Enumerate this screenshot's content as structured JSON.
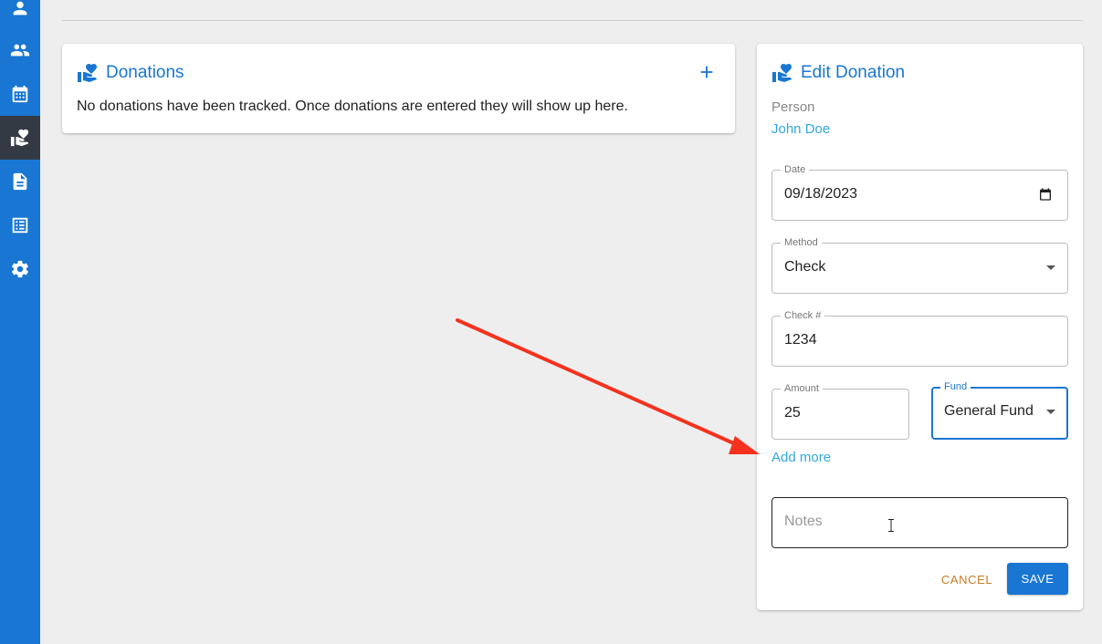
{
  "sidebar": {
    "items": [
      {
        "icon": "person-icon",
        "active": false
      },
      {
        "icon": "people-icon",
        "active": false
      },
      {
        "icon": "calendar-icon",
        "active": false
      },
      {
        "icon": "donation-hand-icon",
        "active": true
      },
      {
        "icon": "document-icon",
        "active": false
      },
      {
        "icon": "list-icon",
        "active": false
      },
      {
        "icon": "gear-icon",
        "active": false
      }
    ]
  },
  "donations": {
    "title": "Donations",
    "empty_message": "No donations have been tracked. Once donations are entered they will show up here."
  },
  "edit_donation": {
    "title": "Edit Donation",
    "person_label": "Person",
    "person_name": "John Doe",
    "date": {
      "label": "Date",
      "value": "09/18/2023"
    },
    "method": {
      "label": "Method",
      "value": "Check"
    },
    "check_number": {
      "label": "Check #",
      "value": "1234"
    },
    "amount": {
      "label": "Amount",
      "value": "25"
    },
    "fund": {
      "label": "Fund",
      "value": "General Fund"
    },
    "add_more": "Add more",
    "notes": {
      "placeholder": "Notes",
      "value": ""
    },
    "cancel_label": "CANCEL",
    "save_label": "SAVE"
  },
  "colors": {
    "primary": "#1976d2",
    "link": "#31a8e0",
    "cancel": "#c97b24",
    "annotation_arrow": "#f5321e",
    "sidebar_active": "#333a44"
  }
}
